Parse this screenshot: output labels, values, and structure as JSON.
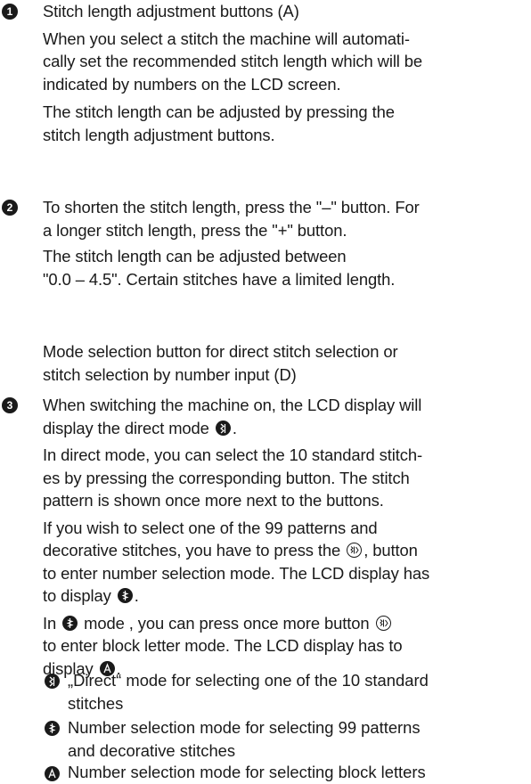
{
  "section1": {
    "marker": "1",
    "heading": "Stitch length adjustment buttons (A)",
    "para1_l1": "When you select a stitch the machine will automati-",
    "para1_l2": "cally set the recommended stitch length which will be",
    "para1_l3": "indicated by numbers on the LCD screen.",
    "para2_l1": "The stitch length can be adjusted by pressing the",
    "para2_l2": "stitch length adjustment buttons."
  },
  "section2": {
    "marker": "2",
    "para1_l1": "To shorten the stitch length, press the \"–\" button. For",
    "para1_l2": "a longer stitch length, press the \"+\" button.",
    "para2_l1": "The stitch length can be adjusted between",
    "para2_l2": "\"0.0 – 4.5\". Certain stitches have a limited length."
  },
  "mode_heading": {
    "l1": "Mode selection button for direct stitch selection or",
    "l2": "stitch selection by number input (D)"
  },
  "section3": {
    "marker": "3",
    "p1_l1": "When switching the machine on, the LCD display will",
    "p1_l2a": "display the direct mode",
    "p1_l2b": ".",
    "p2_l1": "In direct mode, you can select the 10 standard stitch-",
    "p2_l2": "es by pressing the corresponding button. The stitch",
    "p2_l3": "pattern is shown once more next to the buttons.",
    "p3_l1": "If you wish to select one of the 99 patterns and",
    "p3_l2a": "decorative stitches, you have to press the",
    "p3_l2b": ", button",
    "p3_l3": "to enter number selection mode. The LCD display has",
    "p3_l4a": "to display",
    "p3_l4b": ".",
    "p4_l1a": "In",
    "p4_l1b": "mode , you can press once more button",
    "p4_l2": "to enter block letter mode. The LCD display has to",
    "p4_l3a": "display",
    "p4_l3b": "."
  },
  "legend": [
    {
      "icon": "direct-mode-icon",
      "l1": "„Direct“ mode for selecting one of the 10 standard",
      "l2": "stitches"
    },
    {
      "icon": "number-mode-icon",
      "l1": "Number selection mode for selecting 99 patterns",
      "l2": "and decorative stitches"
    },
    {
      "icon": "letter-mode-icon",
      "l1": "Number selection mode for selecting block letters",
      "l2": ""
    }
  ],
  "colors": {
    "text": "#1a1a1a",
    "background": "#ffffff"
  }
}
